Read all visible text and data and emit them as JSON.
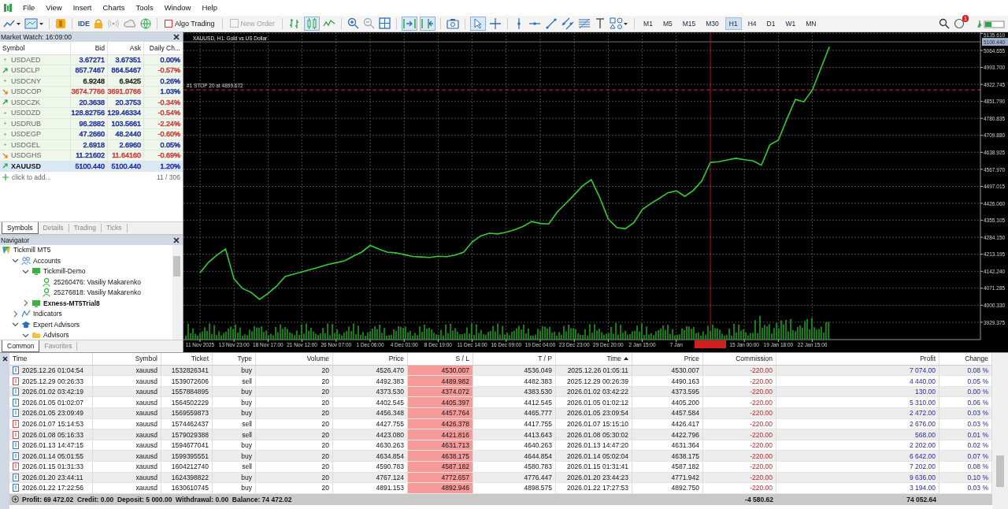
{
  "menu": [
    "File",
    "View",
    "Insert",
    "Charts",
    "Tools",
    "Window",
    "Help"
  ],
  "toolbar": {
    "ide": "IDE",
    "algo_trading": {
      "label": "Algo Trading",
      "on": false
    },
    "new_order": {
      "label": "New Order",
      "disabled": true
    },
    "timeframes": [
      {
        "label": "M1",
        "selected": false
      },
      {
        "label": "M5",
        "selected": false
      },
      {
        "label": "M15",
        "selected": false
      },
      {
        "label": "M30",
        "selected": false
      },
      {
        "label": "H1",
        "selected": true
      },
      {
        "label": "H4",
        "selected": false
      },
      {
        "label": "D1",
        "selected": false
      },
      {
        "label": "W1",
        "selected": false
      },
      {
        "label": "MN",
        "selected": false
      }
    ],
    "notifications": "1"
  },
  "market_watch": {
    "title": "Market Watch: 16:09:00",
    "columns": [
      "Symbol",
      "Bid",
      "Ask",
      "Daily Ch..."
    ],
    "rows": [
      {
        "kind": "flat",
        "symbol": "USDAED",
        "bid": {
          "text": "3.67271",
          "color": "#1f2fa8"
        },
        "ask": {
          "text": "3.67351",
          "color": "#1f2fa8"
        },
        "change": {
          "text": "0.00%",
          "color": "#1f2fa8"
        },
        "selected": false
      },
      {
        "kind": "up",
        "symbol": "USDCLP",
        "bid": {
          "text": "857.7467",
          "color": "#1f2fa8"
        },
        "ask": {
          "text": "864.5467",
          "color": "#1f2fa8"
        },
        "change": {
          "text": "-0.57%",
          "color": "#d23a3a"
        },
        "selected": false
      },
      {
        "kind": "flat",
        "symbol": "USDCNY",
        "bid": {
          "text": "6.9248",
          "color": "#222222"
        },
        "ask": {
          "text": "6.9425",
          "color": "#222222"
        },
        "change": {
          "text": "0.26%",
          "color": "#1f2fa8"
        },
        "selected": false
      },
      {
        "kind": "down",
        "symbol": "USDCOP",
        "bid": {
          "text": "3674.7766",
          "color": "#d23a3a"
        },
        "ask": {
          "text": "3691.0766",
          "color": "#d23a3a"
        },
        "change": {
          "text": "1.03%",
          "color": "#1f2fa8"
        },
        "selected": false
      },
      {
        "kind": "up",
        "symbol": "USDCZK",
        "bid": {
          "text": "20.3638",
          "color": "#1f2fa8"
        },
        "ask": {
          "text": "20.3753",
          "color": "#1f2fa8"
        },
        "change": {
          "text": "-0.34%",
          "color": "#d23a3a"
        },
        "selected": false
      },
      {
        "kind": "flat",
        "symbol": "USDDZD",
        "bid": {
          "text": "128.82756",
          "color": "#1f2fa8"
        },
        "ask": {
          "text": "129.46334",
          "color": "#1f2fa8"
        },
        "change": {
          "text": "-0.54%",
          "color": "#d23a3a"
        },
        "selected": false
      },
      {
        "kind": "flat",
        "symbol": "USDRUB",
        "bid": {
          "text": "96.2882",
          "color": "#1f2fa8"
        },
        "ask": {
          "text": "103.5661",
          "color": "#1f2fa8"
        },
        "change": {
          "text": "-2.24%",
          "color": "#d23a3a"
        },
        "selected": false
      },
      {
        "kind": "flat",
        "symbol": "USDEGP",
        "bid": {
          "text": "47.2660",
          "color": "#1f2fa8"
        },
        "ask": {
          "text": "48.2440",
          "color": "#1f2fa8"
        },
        "change": {
          "text": "-0.60%",
          "color": "#d23a3a"
        },
        "selected": false
      },
      {
        "kind": "flat",
        "symbol": "USDGEL",
        "bid": {
          "text": "2.6918",
          "color": "#1f2fa8"
        },
        "ask": {
          "text": "2.6960",
          "color": "#1f2fa8"
        },
        "change": {
          "text": "0.05%",
          "color": "#1f2fa8"
        },
        "selected": false
      },
      {
        "kind": "down",
        "symbol": "USDGHS",
        "bid": {
          "text": "11.21602",
          "color": "#1f2fa8"
        },
        "ask": {
          "text": "11.64160",
          "color": "#d23a3a"
        },
        "change": {
          "text": "-0.69%",
          "color": "#d23a3a"
        },
        "selected": false
      },
      {
        "kind": "up",
        "symbol": "XAUUSD",
        "bid": {
          "text": "5100.440",
          "color": "#1f2fa8"
        },
        "ask": {
          "text": "5100.440",
          "color": "#1f2fa8"
        },
        "change": {
          "text": "1.20%",
          "color": "#1f2fa8"
        },
        "selected": true
      }
    ],
    "add_label": "click to add...",
    "count": "11 / 306",
    "tabs": [
      {
        "label": "Symbols",
        "selected": true
      },
      {
        "label": "Details",
        "selected": false
      },
      {
        "label": "Trading",
        "selected": false
      },
      {
        "label": "Ticks",
        "selected": false
      }
    ]
  },
  "navigator": {
    "title": "Navigator",
    "items": [
      {
        "label": "Tickmill MT5",
        "kind": "broker",
        "children": [
          {
            "label": "Accounts",
            "kind": "accounts",
            "expanded": true,
            "children": [
              {
                "label": "Tickmill-Demo",
                "kind": "server",
                "expanded": true,
                "active": false,
                "children": [
                  {
                    "label": "25260476: Vasiliy Makarenko",
                    "kind": "account"
                  },
                  {
                    "label": "25276818: Vasiliy Makarenko",
                    "kind": "account"
                  }
                ]
              },
              {
                "label": "Exness-MT5Trial8",
                "kind": "server",
                "expanded": false,
                "active": true
              }
            ]
          },
          {
            "label": "Indicators",
            "kind": "indicators",
            "expanded": false
          },
          {
            "label": "Expert Advisors",
            "kind": "experts",
            "expanded": true,
            "children": [
              {
                "label": "Advisors",
                "kind": "folder",
                "expanded": true
              }
            ]
          }
        ]
      }
    ],
    "tabs": [
      {
        "label": "Common",
        "selected": true
      },
      {
        "label": "Favorites",
        "selected": false
      }
    ]
  },
  "chart": {
    "title": "XAUUSD, H1:  Gold vs US Dollar",
    "chart_data": {
      "type": "line",
      "grid": true,
      "categories": [
        "11 Nov 2025",
        null,
        null,
        null,
        "13 Nov 23:00",
        null,
        null,
        null,
        "18 Nov 17:00",
        null,
        null,
        null,
        "21 Nov 12:00",
        null,
        null,
        null,
        "26 Nov 07:00",
        null,
        null,
        null,
        "1 Dec 06:00",
        null,
        null,
        null,
        "4 Dec 01:00",
        null,
        null,
        null,
        "8 Dec 19:00",
        null,
        null,
        null,
        "11 Dec 14:00",
        null,
        null,
        null,
        "16 Dec 09:00",
        null,
        null,
        null,
        "19 Dec 04:00",
        null,
        null,
        null,
        "23 Dec 23:00",
        null,
        null,
        null,
        "29 Dec 20:00",
        null,
        null,
        null,
        "2 Jan 15:00",
        null,
        null,
        null,
        "7 Jan",
        null,
        null,
        null,
        null,
        null,
        null,
        null,
        "15 Jan 00:00",
        null,
        null,
        null,
        "19 Jan 18:00",
        null,
        null,
        null,
        "22 Jan 15:00",
        null,
        null,
        null,
        null,
        null,
        null,
        null,
        null,
        null,
        null,
        null,
        null,
        null,
        null,
        null,
        null,
        null,
        null,
        null,
        null
      ],
      "ylim": [
        3856.8,
        5140.3
      ],
      "series": [
        {
          "color": "#32cd32",
          "values": [
            4136,
            4180,
            4210,
            4235,
            4110,
            4070,
            4054,
            4025,
            4050,
            4080,
            4120,
            4130,
            4140,
            4150,
            4160,
            4170,
            4178,
            4186,
            4205,
            4222,
            4250,
            4235,
            4222,
            4219,
            4212,
            4204,
            4202,
            4200,
            4205,
            4203,
            4210,
            4222,
            4265,
            4290,
            4301,
            4298,
            4305,
            4316,
            4330,
            4350,
            4342,
            4340,
            4390,
            4425,
            4462,
            4500,
            4525,
            4450,
            4360,
            4325,
            4320,
            4345,
            4400,
            4425,
            4447,
            4470,
            4478,
            4455,
            4480,
            4520,
            4597,
            4600,
            4607,
            4614,
            4608,
            4604,
            4585,
            4670,
            4690,
            4778,
            4860,
            4850,
            4900,
            4990,
            5080,
            null,
            null,
            null,
            null,
            null,
            null,
            null,
            null,
            null,
            null,
            null,
            null,
            null,
            null,
            null,
            null,
            null,
            null
          ]
        }
      ],
      "yticks": [
        {
          "value": 5135.61,
          "label": "5135.610"
        },
        {
          "value": 5064.655,
          "label": "5064.655"
        },
        {
          "value": 4993.7,
          "label": "4993.700"
        },
        {
          "value": 4922.745,
          "label": "4922.745"
        },
        {
          "value": 4851.79,
          "label": "4851.790"
        },
        {
          "value": 4780.835,
          "label": "4780.835"
        },
        {
          "value": 4709.88,
          "label": "4709.880"
        },
        {
          "value": 4638.925,
          "label": "4638.925"
        },
        {
          "value": 4567.97,
          "label": "4567.970"
        },
        {
          "value": 4497.015,
          "label": "4497.015"
        },
        {
          "value": 4426.06,
          "label": "4426.060"
        },
        {
          "value": 4355.105,
          "label": "4355.105"
        },
        {
          "value": 4284.15,
          "label": "4284.150"
        },
        {
          "value": 4213.195,
          "label": "4213.195"
        },
        {
          "value": 4142.24,
          "label": "4142.240"
        },
        {
          "value": 4071.285,
          "label": "4071.285"
        },
        {
          "value": 4000.33,
          "label": "4000.330"
        },
        {
          "value": 3929.375,
          "label": "3929.375"
        }
      ],
      "ref_lines": [
        {
          "axis": "y",
          "value": 5100.44,
          "label": "5100.440",
          "color": "#8a8f98"
        },
        {
          "axis": "y",
          "value": 4899.672,
          "label": "#1 STOP 20 at 4899.672",
          "color": "#b02020"
        }
      ]
    }
  },
  "trades": {
    "columns": [
      {
        "label": "Time",
        "sorted": false
      },
      {
        "label": "Symbol",
        "sorted": false
      },
      {
        "label": "Ticket",
        "sorted": false
      },
      {
        "label": "Type",
        "sorted": false
      },
      {
        "label": "Volume",
        "sorted": false
      },
      {
        "label": "Price",
        "sorted": false
      },
      {
        "label": "S / L",
        "sorted": false
      },
      {
        "label": "T / P",
        "sorted": false
      },
      {
        "label": "Time",
        "sorted": true
      },
      {
        "label": "Price",
        "sorted": false
      },
      {
        "label": "Commission",
        "sorted": false
      },
      {
        "label": "Profit",
        "sorted": false
      },
      {
        "label": "Change",
        "sorted": false
      }
    ],
    "rows": [
      {
        "kind": "long",
        "cells": [
          "2025.12.26 01:04:54",
          "xauusd",
          "1532826341",
          "buy",
          "20",
          "4526.470",
          "4530.007",
          "4536.049",
          "2025.12.26 01:05:11",
          "4530.007",
          "-220.00",
          "7 074.00",
          "0.08 %"
        ]
      },
      {
        "kind": "short",
        "cells": [
          "2025.12.29 00:26:33",
          "xauusd",
          "1539072606",
          "sell",
          "20",
          "4492.383",
          "4489.982",
          "4482.383",
          "2025.12.29 00:26:39",
          "4490.163",
          "-220.00",
          "4 440.00",
          "0.05 %"
        ]
      },
      {
        "kind": "long",
        "cells": [
          "2026.01.02 03:42:19",
          "xauusd",
          "1557884895",
          "buy",
          "20",
          "4373.530",
          "4374.072",
          "4383.530",
          "2026.01.02 03:42:22",
          "4373.595",
          "-220.00",
          "130.00",
          "0.00 %"
        ]
      },
      {
        "kind": "long",
        "cells": [
          "2026.01.05 01:02:07",
          "xauusd",
          "1564502229",
          "buy",
          "20",
          "4402.545",
          "4405.397",
          "4412.545",
          "2026.01.05 01:02:12",
          "4405.200",
          "-220.00",
          "5 310.00",
          "0.06 %"
        ]
      },
      {
        "kind": "long",
        "cells": [
          "2026.01.05 23:09:49",
          "xauusd",
          "1569559873",
          "buy",
          "20",
          "4456.348",
          "4457.764",
          "4465.777",
          "2026.01.05 23:09:54",
          "4457.584",
          "-220.00",
          "2 472.00",
          "0.03 %"
        ]
      },
      {
        "kind": "short",
        "cells": [
          "2026.01.07 15:14:53",
          "xauusd",
          "1574462437",
          "sell",
          "20",
          "4427.755",
          "4426.378",
          "4417.755",
          "2026.01.07 15:15:10",
          "4426.417",
          "-220.00",
          "2 676.00",
          "0.03 %"
        ]
      },
      {
        "kind": "short",
        "cells": [
          "2026.01.08 05:16:33",
          "xauusd",
          "1579029388",
          "sell",
          "20",
          "4423.080",
          "4421.816",
          "4413.643",
          "2026.01.08 05:30:02",
          "4422.796",
          "-220.00",
          "568.00",
          "0.01 %"
        ]
      },
      {
        "kind": "long",
        "cells": [
          "2026.01.13 14:47:15",
          "xauusd",
          "1594677041",
          "buy",
          "20",
          "4630.263",
          "4631.713",
          "4640.263",
          "2026.01.13 14:47:20",
          "4631.364",
          "-220.00",
          "2 202.00",
          "0.02 %"
        ]
      },
      {
        "kind": "long",
        "cells": [
          "2026.01.14 05:01:55",
          "xauusd",
          "1599395551",
          "buy",
          "20",
          "4634.854",
          "4638.175",
          "4644.854",
          "2026.01.14 05:02:04",
          "4638.175",
          "-220.00",
          "6 642.00",
          "0.07 %"
        ]
      },
      {
        "kind": "short",
        "cells": [
          "2026.01.15 01:31:33",
          "xauusd",
          "1604212740",
          "sell",
          "20",
          "4590.783",
          "4587.182",
          "4580.783",
          "2026.01.15 01:31:41",
          "4587.182",
          "-220.00",
          "7 202.00",
          "0.08 %"
        ]
      },
      {
        "kind": "long",
        "cells": [
          "2026.01.20 23:44:11",
          "xauusd",
          "1624398822",
          "buy",
          "20",
          "4767.124",
          "4772.657",
          "4776.447",
          "2026.01.20 23:44:23",
          "4771.942",
          "-220.00",
          "9 636.00",
          "0.10 %"
        ]
      },
      {
        "kind": "long",
        "cells": [
          "2026.01.22 17:22:56",
          "xauusd",
          "1630610745",
          "buy",
          "20",
          "4891.153",
          "4892.946",
          "4898.575",
          "2026.01.22 17:27:53",
          "4892.750",
          "-220.00",
          "3 194.00",
          "0.03 %"
        ]
      }
    ],
    "summary": {
      "text": "Profit: 69 472.02  Credit: 0.00  Deposit: 5 000.00  Withdrawal: 0.00  Balance: 74 472.02",
      "commission": "-4 580.62",
      "profit": "74 052.64"
    }
  }
}
